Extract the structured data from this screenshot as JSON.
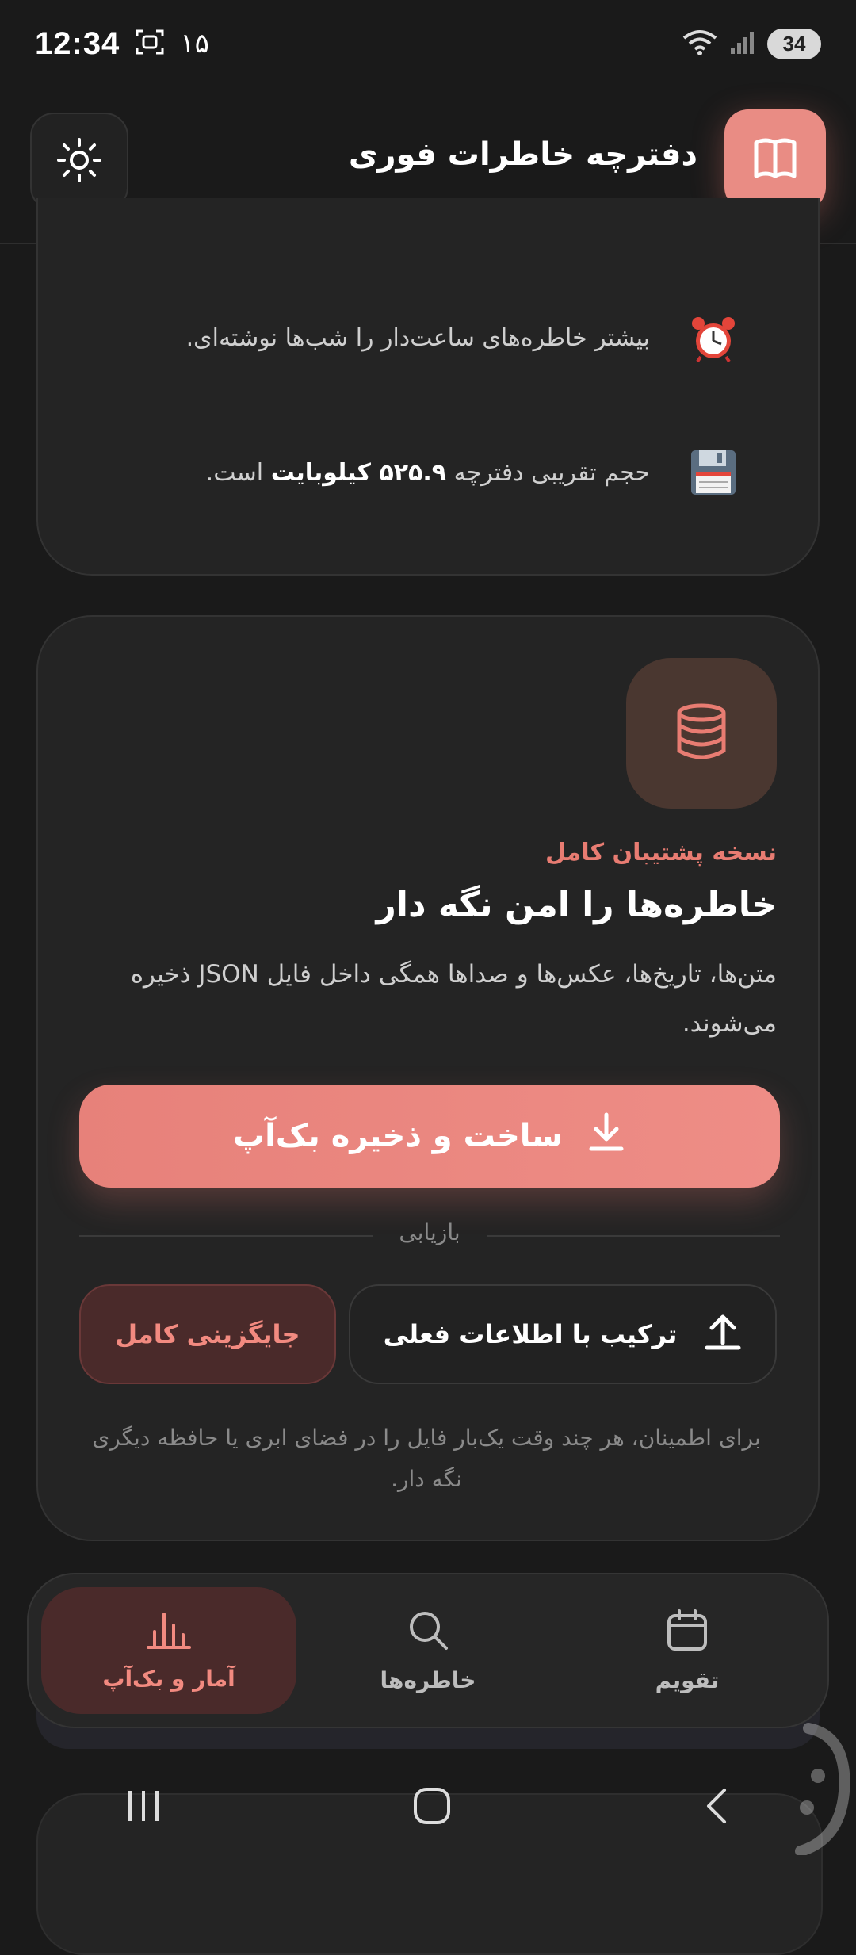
{
  "status_bar": {
    "time": "12:34",
    "notification_count": "۱۵",
    "battery": "34"
  },
  "header": {
    "title": "دفترچه خاطرات فوری",
    "logo_icon": "book-icon",
    "theme_icon": "sun-icon"
  },
  "stats": {
    "items": [
      {
        "icon": "alarm-clock-icon",
        "text": "بیشتر خاطره‌های ساعت‌دار را شب‌ها نوشته‌ای."
      },
      {
        "icon": "floppy-disk-icon",
        "prefix": "حجم تقریبی دفترچه",
        "value": "۵۲۵.۹ کیلوبایت",
        "suffix": "است."
      }
    ]
  },
  "backup": {
    "icon": "database-icon",
    "eyebrow": "نسخه پشتیبان کامل",
    "title": "خاطره‌ها را امن نگه دار",
    "description": "متن‌ها، تاریخ‌ها، عکس‌ها و صداها همگی داخل فایل JSON ذخیره می‌شوند.",
    "primary_button": "ساخت و ذخیره بک‌آپ",
    "restore_label": "بازیابی",
    "merge_button": "ترکیب با اطلاعات فعلی",
    "replace_button": "جایگزینی کامل",
    "note": "برای اطمینان، هر چند وقت یک‌بار فایل را در فضای ابری یا حافظه دیگری نگه دار."
  },
  "nav": {
    "items": [
      {
        "label": "آمار و بک‌آپ",
        "icon": "bar-chart-icon",
        "active": true
      },
      {
        "label": "خاطره‌ها",
        "icon": "search-icon",
        "active": false
      },
      {
        "label": "تقویم",
        "icon": "calendar-icon",
        "active": false
      }
    ]
  },
  "colors": {
    "accent": "#e98c84",
    "background": "#1a1a1a",
    "card": "#242424"
  }
}
